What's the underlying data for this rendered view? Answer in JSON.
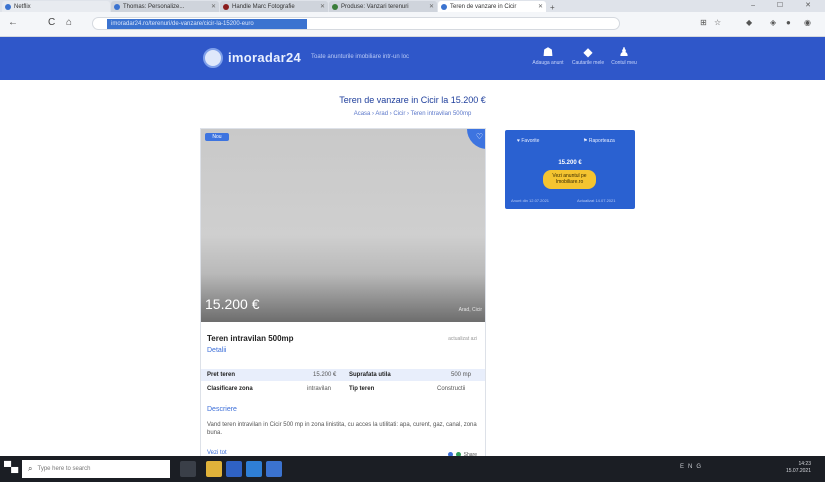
{
  "browser": {
    "tabs": [
      {
        "label": "Netflix",
        "color": "#3b73d0"
      },
      {
        "label": "Thomas: Personalize...",
        "color": "#3b73d0"
      },
      {
        "label": "Handle Marc Fotografie",
        "color": "#8a1c1c"
      },
      {
        "label": "Produse: Vanzari terenuri",
        "color": "#3a7d3a"
      },
      {
        "label": "Teren de vanzare in Cicir",
        "color": "#3b73d0"
      }
    ],
    "new_tab": "+",
    "window_controls": "– ☐ ✕",
    "back": "←",
    "refresh": "C",
    "home": "⌂",
    "address": "imoradar24.ro/terenuri/de-vanzare/cicir-la-15200-euro"
  },
  "site": {
    "logo_text": "imoradar24",
    "tagline": "Toate anunturile imobiliare intr-un loc",
    "nav": [
      {
        "label": "Adauga anunt",
        "icon": "home-icon",
        "glyph": "☗"
      },
      {
        "label": "Cautarile mele",
        "icon": "tag-icon",
        "glyph": "◆"
      },
      {
        "label": "Contul meu",
        "icon": "user-icon",
        "glyph": "♟"
      }
    ]
  },
  "page": {
    "title": "Teren de vanzare in Cicir la 15.200 €",
    "breadcrumb": "Acasa › Arad › Cicir › Teren intravilan 500mp"
  },
  "listing": {
    "badge": "Nou",
    "price": "15.200 €",
    "photo_meta": "Arad, Cicir",
    "title": "Teren intravilan 500mp",
    "date": "actualizat azi",
    "details_link": "Detalii",
    "specs": [
      {
        "k1": "Pret teren",
        "v1": "15.200 €",
        "k2": "Suprafata utila",
        "v2": "500 mp"
      },
      {
        "k1": "Clasificare zona",
        "v1": "intravilan",
        "k2": "Tip teren",
        "v2": "Constructii"
      }
    ],
    "section_title": "Descriere",
    "description": "Vand teren intravilan in Cicir 500 mp in zona linistita, cu acces la utilitati: apa, curent, gaz, canal, zona buna.",
    "see_more": "Vezi tot",
    "share": "Share"
  },
  "sidebar": {
    "favorite": "Favorite",
    "report": "Raporteaza",
    "price": "15.200 €",
    "cta": "Vezi anuntul pe Imobiliare.ro",
    "foot_left": "Anunt din 12.07.2021",
    "foot_right": "Actualizat 14.07.2021"
  },
  "taskbar": {
    "search_placeholder": "Type here to search",
    "tray": "ENG",
    "time": "14:23",
    "date": "15.07.2021",
    "apps": [
      {
        "icon": "task-view-icon",
        "color": "#3a3f48"
      },
      {
        "icon": "file-explorer-icon",
        "color": "#e0b23a"
      },
      {
        "icon": "chrome-icon",
        "color": "#2f62c4"
      },
      {
        "icon": "edge-icon",
        "color": "#2f7fd6"
      },
      {
        "icon": "mail-icon",
        "color": "#3b73d0"
      }
    ]
  }
}
